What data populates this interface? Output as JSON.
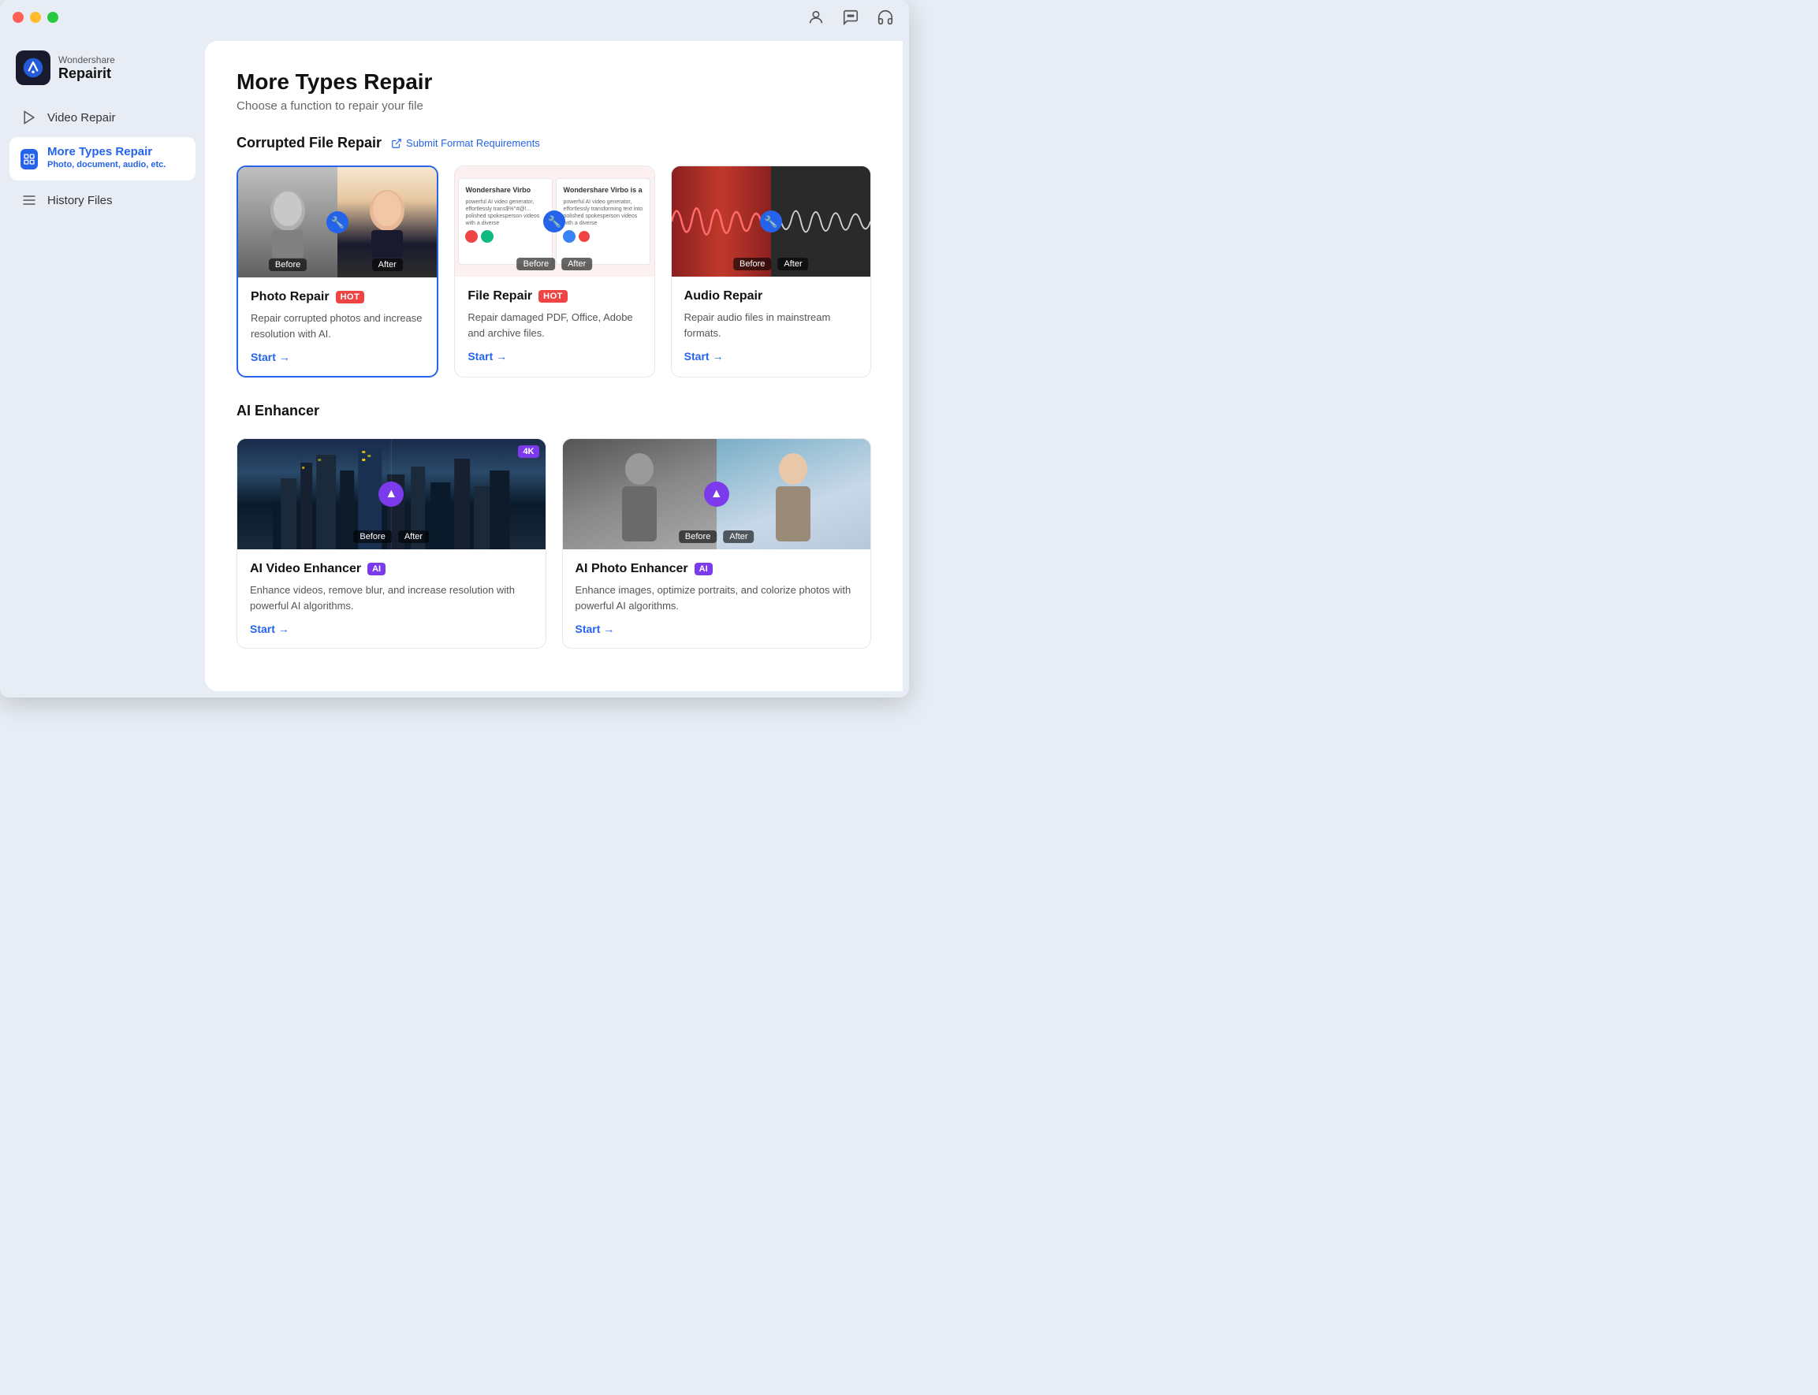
{
  "app": {
    "brand_top": "Wondershare",
    "brand_name": "Repairit"
  },
  "titlebar": {
    "title": "Wondershare Repairit"
  },
  "sidebar": {
    "items": [
      {
        "id": "video-repair",
        "label": "Video Repair",
        "active": false
      },
      {
        "id": "more-types-repair",
        "label": "More Types Repair",
        "active": true,
        "sub": "Photo, document, audio, etc."
      },
      {
        "id": "history-files",
        "label": "History Files",
        "active": false
      }
    ]
  },
  "main": {
    "page_title": "More Types Repair",
    "page_subtitle": "Choose a function to repair your file",
    "corrupted_section": {
      "title": "Corrupted File Repair",
      "submit_link": "Submit Format Requirements"
    },
    "cards": [
      {
        "id": "photo-repair",
        "title": "Photo Repair",
        "badge": "HOT",
        "badge_type": "hot",
        "desc": "Repair corrupted photos and increase resolution with AI.",
        "start": "Start →",
        "selected": true
      },
      {
        "id": "file-repair",
        "title": "File Repair",
        "badge": "HOT",
        "badge_type": "hot",
        "desc": "Repair damaged PDF, Office, Adobe and archive files.",
        "start": "Start →",
        "selected": false
      },
      {
        "id": "audio-repair",
        "title": "Audio Repair",
        "badge": null,
        "desc": "Repair audio files in mainstream formats.",
        "start": "Start →",
        "selected": false
      }
    ],
    "ai_section": {
      "title": "AI Enhancer"
    },
    "ai_cards": [
      {
        "id": "ai-video-enhancer",
        "title": "AI Video Enhancer",
        "badge": "AI",
        "badge_type": "ai",
        "desc": "Enhance videos, remove blur, and increase resolution with powerful AI algorithms.",
        "start": "Start →"
      },
      {
        "id": "ai-photo-enhancer",
        "title": "AI Photo Enhancer",
        "badge": "AI",
        "badge_type": "ai",
        "desc": "Enhance images, optimize portraits, and colorize photos with powerful AI algorithms.",
        "start": "Start →"
      }
    ],
    "before_label": "Before",
    "after_label": "After"
  },
  "icons": {
    "user": "👤",
    "chat": "💬",
    "headset": "🎧",
    "external_link": "↗",
    "arrow_right": "→"
  }
}
